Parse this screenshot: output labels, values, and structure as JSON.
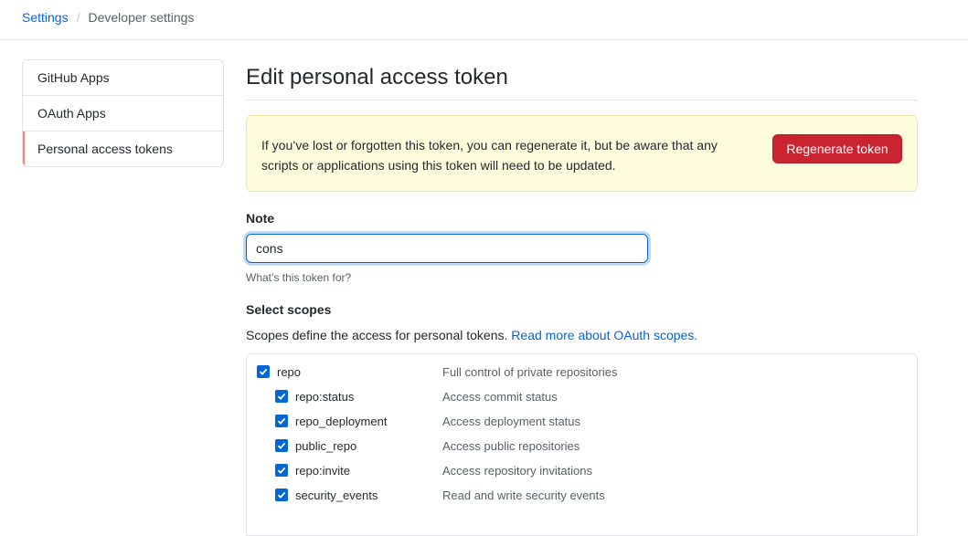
{
  "breadcrumb": {
    "settings_link": "Settings",
    "separator": "/",
    "current": "Developer settings"
  },
  "sidebar": {
    "items": [
      {
        "label": "GitHub Apps"
      },
      {
        "label": "OAuth Apps"
      },
      {
        "label": "Personal access tokens"
      }
    ],
    "selected_accent": "#f9826c"
  },
  "main": {
    "title": "Edit personal access token",
    "flash": {
      "message": "If you’ve lost or forgotten this token, you can regenerate it, but be aware that any scripts or applications using this token will need to be updated.",
      "button_label": "Regenerate token"
    },
    "note": {
      "label": "Note",
      "value": "cons",
      "hint": "What’s this token for?"
    },
    "scopes": {
      "label": "Select scopes",
      "description": "Scopes define the access for personal tokens.",
      "link_text": "Read more about OAuth scopes.",
      "items": [
        {
          "name": "repo",
          "description": "Full control of private repositories",
          "checked": true
        },
        {
          "name": "repo:status",
          "description": "Access commit status",
          "checked": true
        },
        {
          "name": "repo_deployment",
          "description": "Access deployment status",
          "checked": true
        },
        {
          "name": "public_repo",
          "description": "Access public repositories",
          "checked": true
        },
        {
          "name": "repo:invite",
          "description": "Access repository invitations",
          "checked": true
        },
        {
          "name": "security_events",
          "description": "Read and write security events",
          "checked": true
        }
      ]
    }
  },
  "colors": {
    "link": "#0366d6",
    "danger": "#cb2431",
    "flash_bg": "#fffbdd",
    "checkbox": "#0366d6"
  }
}
